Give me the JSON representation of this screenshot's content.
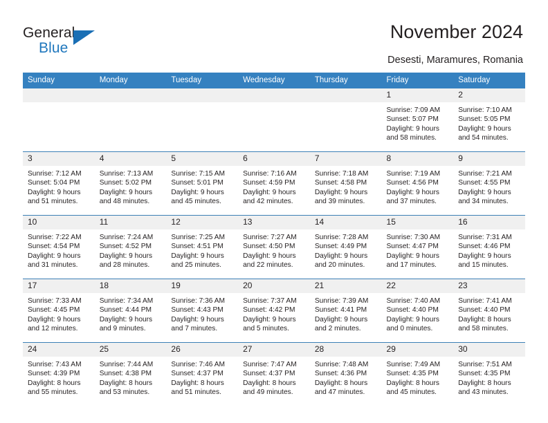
{
  "brand": {
    "name_part1": "General",
    "name_part2": "Blue",
    "logo_icon": "triangle-flag-icon",
    "accent_color": "#1a6fb5"
  },
  "header": {
    "title": "November 2024",
    "location": "Desesti, Maramures, Romania"
  },
  "calendar": {
    "header_bg": "#3581c0",
    "daynum_bg": "#f0f0f0",
    "row_divider_color": "#3b7fb5",
    "weekdays": [
      "Sunday",
      "Monday",
      "Tuesday",
      "Wednesday",
      "Thursday",
      "Friday",
      "Saturday"
    ],
    "weeks": [
      [
        {
          "day": "",
          "sunrise": "",
          "sunset": "",
          "daylight_line1": "",
          "daylight_line2": ""
        },
        {
          "day": "",
          "sunrise": "",
          "sunset": "",
          "daylight_line1": "",
          "daylight_line2": ""
        },
        {
          "day": "",
          "sunrise": "",
          "sunset": "",
          "daylight_line1": "",
          "daylight_line2": ""
        },
        {
          "day": "",
          "sunrise": "",
          "sunset": "",
          "daylight_line1": "",
          "daylight_line2": ""
        },
        {
          "day": "",
          "sunrise": "",
          "sunset": "",
          "daylight_line1": "",
          "daylight_line2": ""
        },
        {
          "day": "1",
          "sunrise": "Sunrise: 7:09 AM",
          "sunset": "Sunset: 5:07 PM",
          "daylight_line1": "Daylight: 9 hours",
          "daylight_line2": "and 58 minutes."
        },
        {
          "day": "2",
          "sunrise": "Sunrise: 7:10 AM",
          "sunset": "Sunset: 5:05 PM",
          "daylight_line1": "Daylight: 9 hours",
          "daylight_line2": "and 54 minutes."
        }
      ],
      [
        {
          "day": "3",
          "sunrise": "Sunrise: 7:12 AM",
          "sunset": "Sunset: 5:04 PM",
          "daylight_line1": "Daylight: 9 hours",
          "daylight_line2": "and 51 minutes."
        },
        {
          "day": "4",
          "sunrise": "Sunrise: 7:13 AM",
          "sunset": "Sunset: 5:02 PM",
          "daylight_line1": "Daylight: 9 hours",
          "daylight_line2": "and 48 minutes."
        },
        {
          "day": "5",
          "sunrise": "Sunrise: 7:15 AM",
          "sunset": "Sunset: 5:01 PM",
          "daylight_line1": "Daylight: 9 hours",
          "daylight_line2": "and 45 minutes."
        },
        {
          "day": "6",
          "sunrise": "Sunrise: 7:16 AM",
          "sunset": "Sunset: 4:59 PM",
          "daylight_line1": "Daylight: 9 hours",
          "daylight_line2": "and 42 minutes."
        },
        {
          "day": "7",
          "sunrise": "Sunrise: 7:18 AM",
          "sunset": "Sunset: 4:58 PM",
          "daylight_line1": "Daylight: 9 hours",
          "daylight_line2": "and 39 minutes."
        },
        {
          "day": "8",
          "sunrise": "Sunrise: 7:19 AM",
          "sunset": "Sunset: 4:56 PM",
          "daylight_line1": "Daylight: 9 hours",
          "daylight_line2": "and 37 minutes."
        },
        {
          "day": "9",
          "sunrise": "Sunrise: 7:21 AM",
          "sunset": "Sunset: 4:55 PM",
          "daylight_line1": "Daylight: 9 hours",
          "daylight_line2": "and 34 minutes."
        }
      ],
      [
        {
          "day": "10",
          "sunrise": "Sunrise: 7:22 AM",
          "sunset": "Sunset: 4:54 PM",
          "daylight_line1": "Daylight: 9 hours",
          "daylight_line2": "and 31 minutes."
        },
        {
          "day": "11",
          "sunrise": "Sunrise: 7:24 AM",
          "sunset": "Sunset: 4:52 PM",
          "daylight_line1": "Daylight: 9 hours",
          "daylight_line2": "and 28 minutes."
        },
        {
          "day": "12",
          "sunrise": "Sunrise: 7:25 AM",
          "sunset": "Sunset: 4:51 PM",
          "daylight_line1": "Daylight: 9 hours",
          "daylight_line2": "and 25 minutes."
        },
        {
          "day": "13",
          "sunrise": "Sunrise: 7:27 AM",
          "sunset": "Sunset: 4:50 PM",
          "daylight_line1": "Daylight: 9 hours",
          "daylight_line2": "and 22 minutes."
        },
        {
          "day": "14",
          "sunrise": "Sunrise: 7:28 AM",
          "sunset": "Sunset: 4:49 PM",
          "daylight_line1": "Daylight: 9 hours",
          "daylight_line2": "and 20 minutes."
        },
        {
          "day": "15",
          "sunrise": "Sunrise: 7:30 AM",
          "sunset": "Sunset: 4:47 PM",
          "daylight_line1": "Daylight: 9 hours",
          "daylight_line2": "and 17 minutes."
        },
        {
          "day": "16",
          "sunrise": "Sunrise: 7:31 AM",
          "sunset": "Sunset: 4:46 PM",
          "daylight_line1": "Daylight: 9 hours",
          "daylight_line2": "and 15 minutes."
        }
      ],
      [
        {
          "day": "17",
          "sunrise": "Sunrise: 7:33 AM",
          "sunset": "Sunset: 4:45 PM",
          "daylight_line1": "Daylight: 9 hours",
          "daylight_line2": "and 12 minutes."
        },
        {
          "day": "18",
          "sunrise": "Sunrise: 7:34 AM",
          "sunset": "Sunset: 4:44 PM",
          "daylight_line1": "Daylight: 9 hours",
          "daylight_line2": "and 9 minutes."
        },
        {
          "day": "19",
          "sunrise": "Sunrise: 7:36 AM",
          "sunset": "Sunset: 4:43 PM",
          "daylight_line1": "Daylight: 9 hours",
          "daylight_line2": "and 7 minutes."
        },
        {
          "day": "20",
          "sunrise": "Sunrise: 7:37 AM",
          "sunset": "Sunset: 4:42 PM",
          "daylight_line1": "Daylight: 9 hours",
          "daylight_line2": "and 5 minutes."
        },
        {
          "day": "21",
          "sunrise": "Sunrise: 7:39 AM",
          "sunset": "Sunset: 4:41 PM",
          "daylight_line1": "Daylight: 9 hours",
          "daylight_line2": "and 2 minutes."
        },
        {
          "day": "22",
          "sunrise": "Sunrise: 7:40 AM",
          "sunset": "Sunset: 4:40 PM",
          "daylight_line1": "Daylight: 9 hours",
          "daylight_line2": "and 0 minutes."
        },
        {
          "day": "23",
          "sunrise": "Sunrise: 7:41 AM",
          "sunset": "Sunset: 4:40 PM",
          "daylight_line1": "Daylight: 8 hours",
          "daylight_line2": "and 58 minutes."
        }
      ],
      [
        {
          "day": "24",
          "sunrise": "Sunrise: 7:43 AM",
          "sunset": "Sunset: 4:39 PM",
          "daylight_line1": "Daylight: 8 hours",
          "daylight_line2": "and 55 minutes."
        },
        {
          "day": "25",
          "sunrise": "Sunrise: 7:44 AM",
          "sunset": "Sunset: 4:38 PM",
          "daylight_line1": "Daylight: 8 hours",
          "daylight_line2": "and 53 minutes."
        },
        {
          "day": "26",
          "sunrise": "Sunrise: 7:46 AM",
          "sunset": "Sunset: 4:37 PM",
          "daylight_line1": "Daylight: 8 hours",
          "daylight_line2": "and 51 minutes."
        },
        {
          "day": "27",
          "sunrise": "Sunrise: 7:47 AM",
          "sunset": "Sunset: 4:37 PM",
          "daylight_line1": "Daylight: 8 hours",
          "daylight_line2": "and 49 minutes."
        },
        {
          "day": "28",
          "sunrise": "Sunrise: 7:48 AM",
          "sunset": "Sunset: 4:36 PM",
          "daylight_line1": "Daylight: 8 hours",
          "daylight_line2": "and 47 minutes."
        },
        {
          "day": "29",
          "sunrise": "Sunrise: 7:49 AM",
          "sunset": "Sunset: 4:35 PM",
          "daylight_line1": "Daylight: 8 hours",
          "daylight_line2": "and 45 minutes."
        },
        {
          "day": "30",
          "sunrise": "Sunrise: 7:51 AM",
          "sunset": "Sunset: 4:35 PM",
          "daylight_line1": "Daylight: 8 hours",
          "daylight_line2": "and 43 minutes."
        }
      ]
    ]
  }
}
